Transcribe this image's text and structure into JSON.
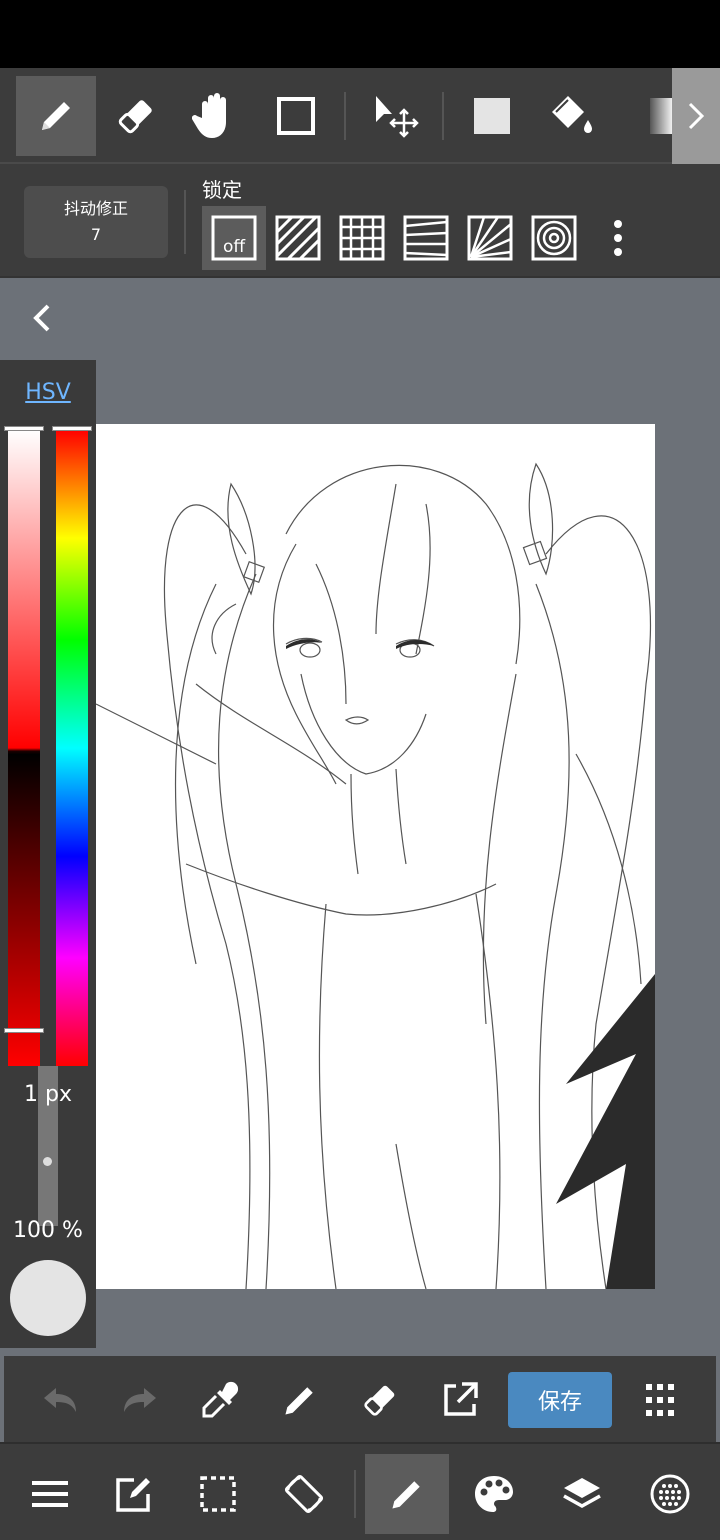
{
  "stabilizer": {
    "label": "抖动修正",
    "value": "7"
  },
  "ruler": {
    "lock_label": "锁定",
    "off_label": "off"
  },
  "color_panel": {
    "mode_tab": "HSV",
    "brush_size": "1 px",
    "opacity": "100 %"
  },
  "actions": {
    "save_label": "保存"
  },
  "colors": {
    "accent": "#4a89c0",
    "current_color": "#e4e4e4",
    "toolbar_bg": "#3c3c3c",
    "workspace_bg": "#6c7178"
  }
}
